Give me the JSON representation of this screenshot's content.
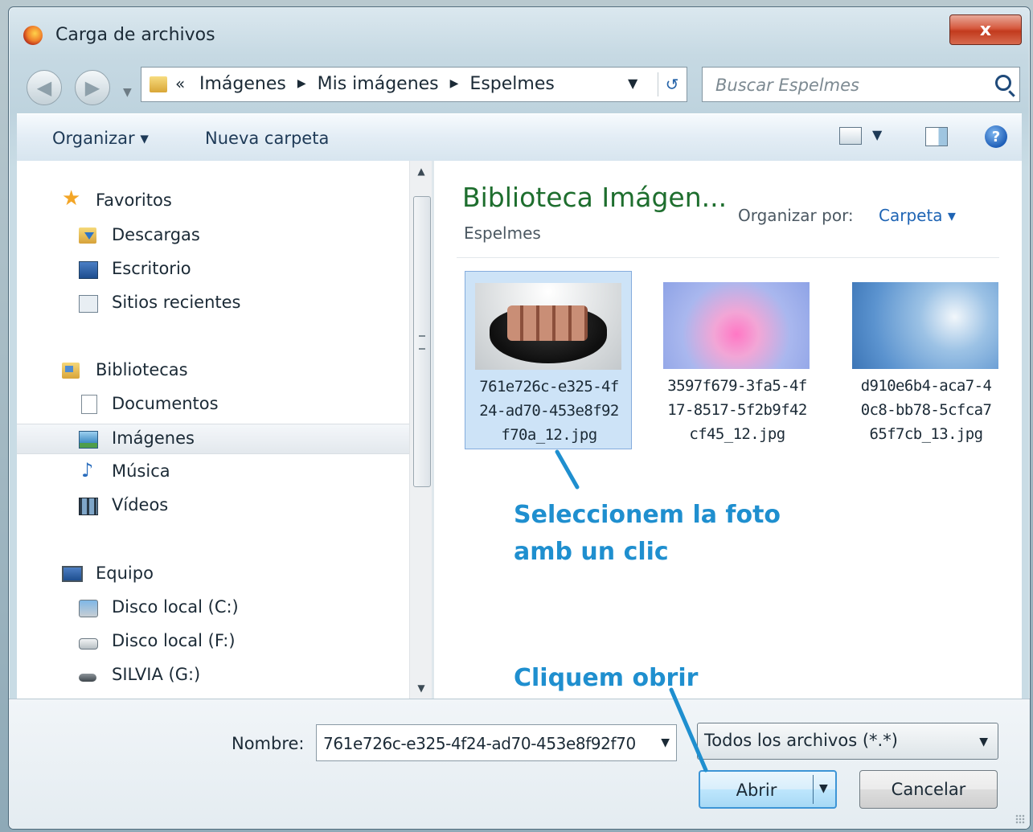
{
  "window": {
    "title": "Carga de archivos",
    "close_label": "x"
  },
  "navigation": {
    "back_icon": "arrow-left-icon",
    "forward_icon": "arrow-right-icon",
    "breadcrumb_prefix": "«",
    "breadcrumbs": [
      "Imágenes",
      "Mis imágenes",
      "Espelmes"
    ],
    "search_placeholder": "Buscar Espelmes"
  },
  "toolbar": {
    "organize_label": "Organizar ▾",
    "new_folder_label": "Nueva carpeta",
    "help_label": "?"
  },
  "nav_pane": {
    "items": [
      {
        "label": "Favoritos",
        "icon": "star-icon"
      },
      {
        "label": "Descargas",
        "icon": "downloads-folder-icon"
      },
      {
        "label": "Escritorio",
        "icon": "desktop-icon"
      },
      {
        "label": "Sitios recientes",
        "icon": "recent-places-icon"
      },
      {
        "label": "Bibliotecas",
        "icon": "libraries-icon"
      },
      {
        "label": "Documentos",
        "icon": "documents-icon"
      },
      {
        "label": "Imágenes",
        "icon": "pictures-icon"
      },
      {
        "label": "Música",
        "icon": "music-icon"
      },
      {
        "label": "Vídeos",
        "icon": "videos-icon"
      },
      {
        "label": "Equipo",
        "icon": "computer-icon"
      },
      {
        "label": "Disco local (C:)",
        "icon": "drive-c-icon"
      },
      {
        "label": "Disco local (F:)",
        "icon": "drive-icon"
      },
      {
        "label": "SILVIA (G:)",
        "icon": "usb-drive-icon"
      }
    ],
    "selected": "Imágenes"
  },
  "content": {
    "library_title": "Biblioteca Imágen...",
    "library_subtitle": "Espelmes",
    "arrange_label": "Organizar por:",
    "arrange_value": "Carpeta ▾",
    "files": [
      {
        "line1": "761e726c-e325-4f",
        "line2": "24-ad70-453e8f92",
        "line3": "f70a_12.jpg",
        "selected": true
      },
      {
        "line1": "3597f679-3fa5-4f",
        "line2": "17-8517-5f2b9f42",
        "line3": "cf45_12.jpg",
        "selected": false
      },
      {
        "line1": "d910e6b4-aca7-4",
        "line2": "0c8-bb78-5cfca7",
        "line3": "65f7cb_13.jpg",
        "selected": false
      }
    ]
  },
  "annotations": {
    "select_line1": "Seleccionem la foto",
    "select_line2": "amb un clic",
    "open_hint": "Cliquem obrir",
    "color": "#1f8fcf"
  },
  "footer": {
    "name_label": "Nombre:",
    "name_value": "761e726c-e325-4f24-ad70-453e8f92f70",
    "type_value": "Todos los archivos (*.*)",
    "open_label": "Abrir",
    "cancel_label": "Cancelar"
  }
}
